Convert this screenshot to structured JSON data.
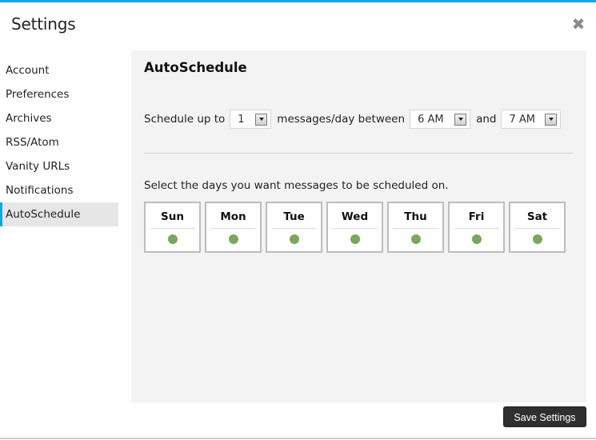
{
  "dialog": {
    "title": "Settings",
    "close_icon": "close-x-icon",
    "accent_color": "#13a6e3"
  },
  "sidebar": {
    "items": [
      {
        "label": "Account",
        "active": false
      },
      {
        "label": "Preferences",
        "active": false
      },
      {
        "label": "Archives",
        "active": false
      },
      {
        "label": "RSS/Atom",
        "active": false
      },
      {
        "label": "Vanity URLs",
        "active": false
      },
      {
        "label": "Notifications",
        "active": false
      },
      {
        "label": "AutoSchedule",
        "active": true
      }
    ]
  },
  "panel": {
    "title": "AutoSchedule",
    "schedule": {
      "prefix": "Schedule up to",
      "count_value": "1",
      "middle": "messages/day between",
      "from_value": "6 AM",
      "conjunction": "and",
      "to_value": "7 AM"
    },
    "days_label": "Select the days you want messages to be scheduled on.",
    "days": [
      {
        "label": "Sun",
        "enabled": true
      },
      {
        "label": "Mon",
        "enabled": true
      },
      {
        "label": "Tue",
        "enabled": true
      },
      {
        "label": "Wed",
        "enabled": true
      },
      {
        "label": "Thu",
        "enabled": true
      },
      {
        "label": "Fri",
        "enabled": true
      },
      {
        "label": "Sat",
        "enabled": true
      }
    ],
    "enabled_dot_color": "#7aa85a"
  },
  "footer": {
    "save_label": "Save Settings"
  }
}
